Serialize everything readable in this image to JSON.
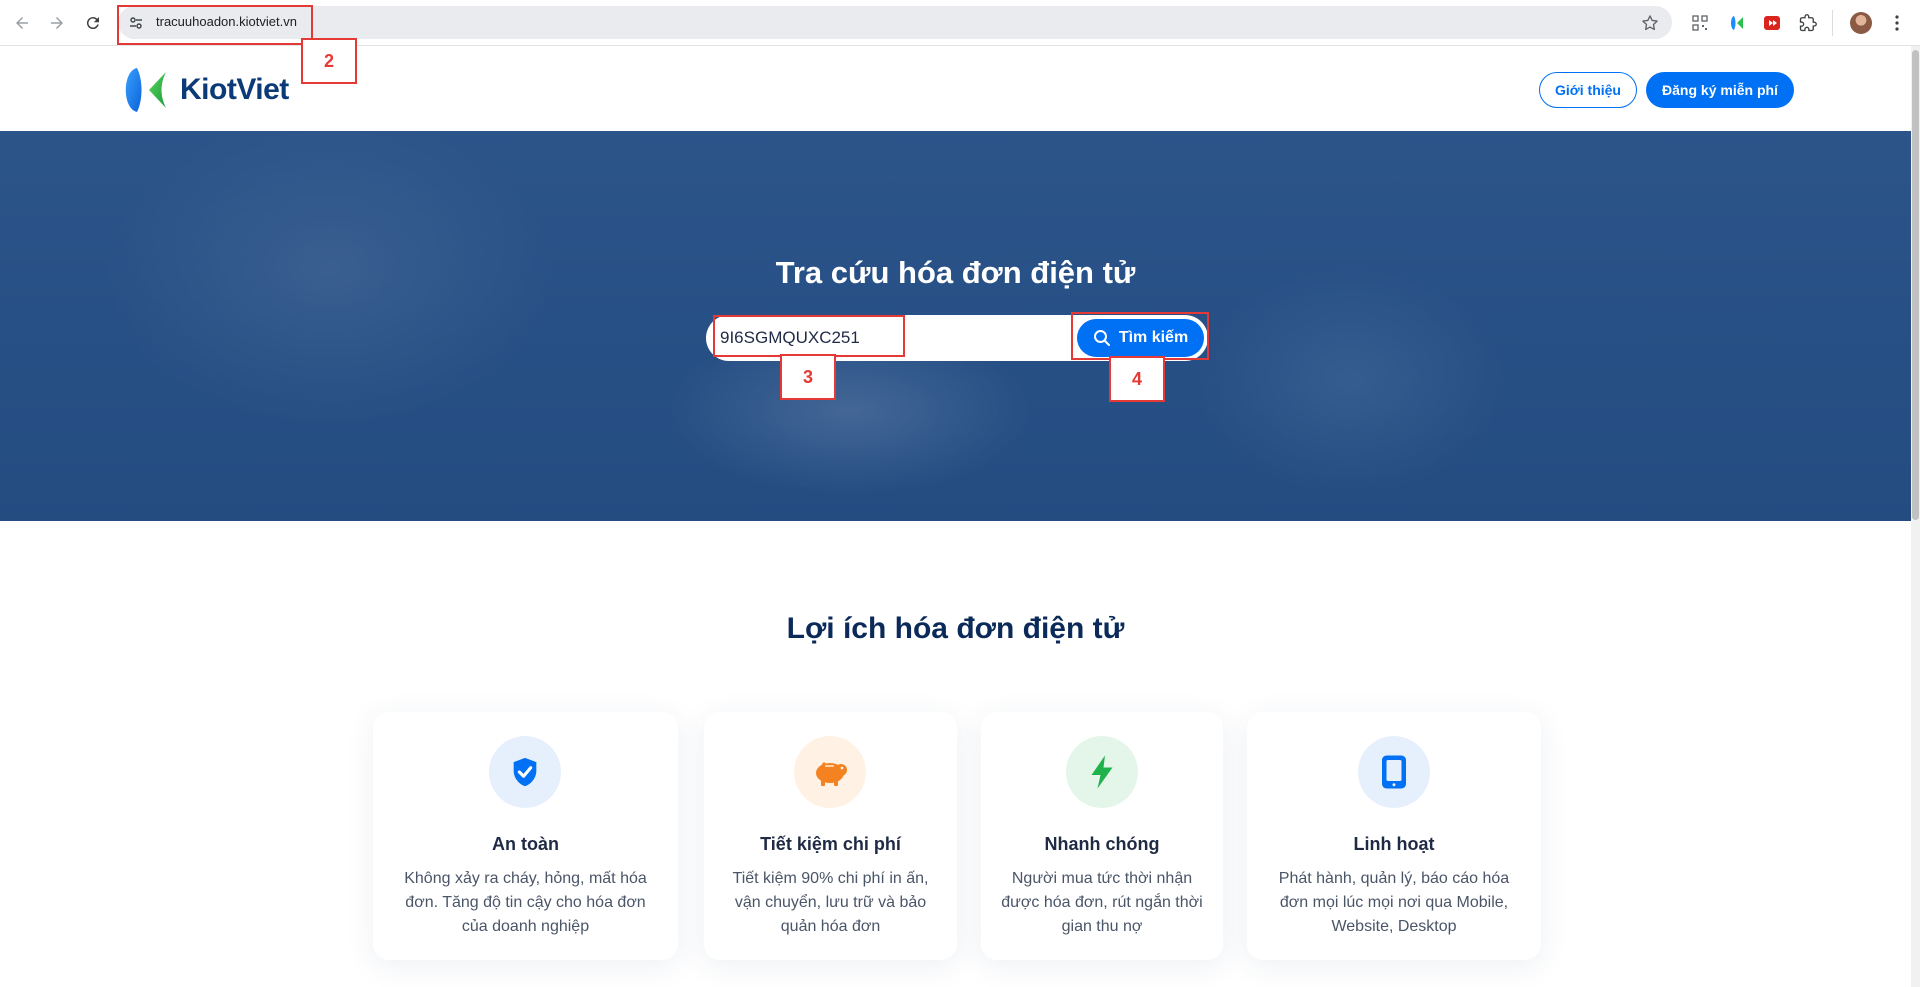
{
  "browser": {
    "url": "tracuuhoadon.kiotviet.vn"
  },
  "header": {
    "logo_text": "KiotViet",
    "intro_label": "Giới thiệu",
    "register_label": "Đăng ký miễn phí"
  },
  "hero": {
    "title": "Tra cứu hóa đơn điện tử",
    "search_value": "9I6SGMQUXC251",
    "search_button_label": "Tìm kiếm"
  },
  "annotations": {
    "url_marker": "2",
    "input_marker": "3",
    "button_marker": "4"
  },
  "benefits": {
    "title": "Lợi ích hóa đơn điện tử",
    "cards": [
      {
        "icon": "shield-check-icon",
        "title": "An toàn",
        "desc": "Không xảy ra cháy, hỏng, mất hóa đơn. Tăng độ tin cậy cho hóa đơn của doanh nghiệp",
        "icon_bg": "#e6f0fd",
        "icon_color": "#0070f4"
      },
      {
        "icon": "piggy-bank-icon",
        "title": "Tiết kiệm chi phí",
        "desc": "Tiết kiệm 90% chi phí in ấn, vận chuyển, lưu trữ và bảo quản hóa đơn",
        "icon_bg": "#fff1e3",
        "icon_color": "#f58220"
      },
      {
        "icon": "lightning-icon",
        "title": "Nhanh chóng",
        "desc": "Người mua tức thời nhận được hóa đơn, rút ngắn thời gian thu nợ",
        "icon_bg": "#e4f6ea",
        "icon_color": "#1fb24a"
      },
      {
        "icon": "tablet-icon",
        "title": "Linh hoạt",
        "desc": "Phát hành, quản lý, báo cáo hóa đơn mọi lúc mọi nơi qua Mobile, Website, Desktop",
        "icon_bg": "#e6f0fd",
        "icon_color": "#0070f4"
      }
    ]
  }
}
